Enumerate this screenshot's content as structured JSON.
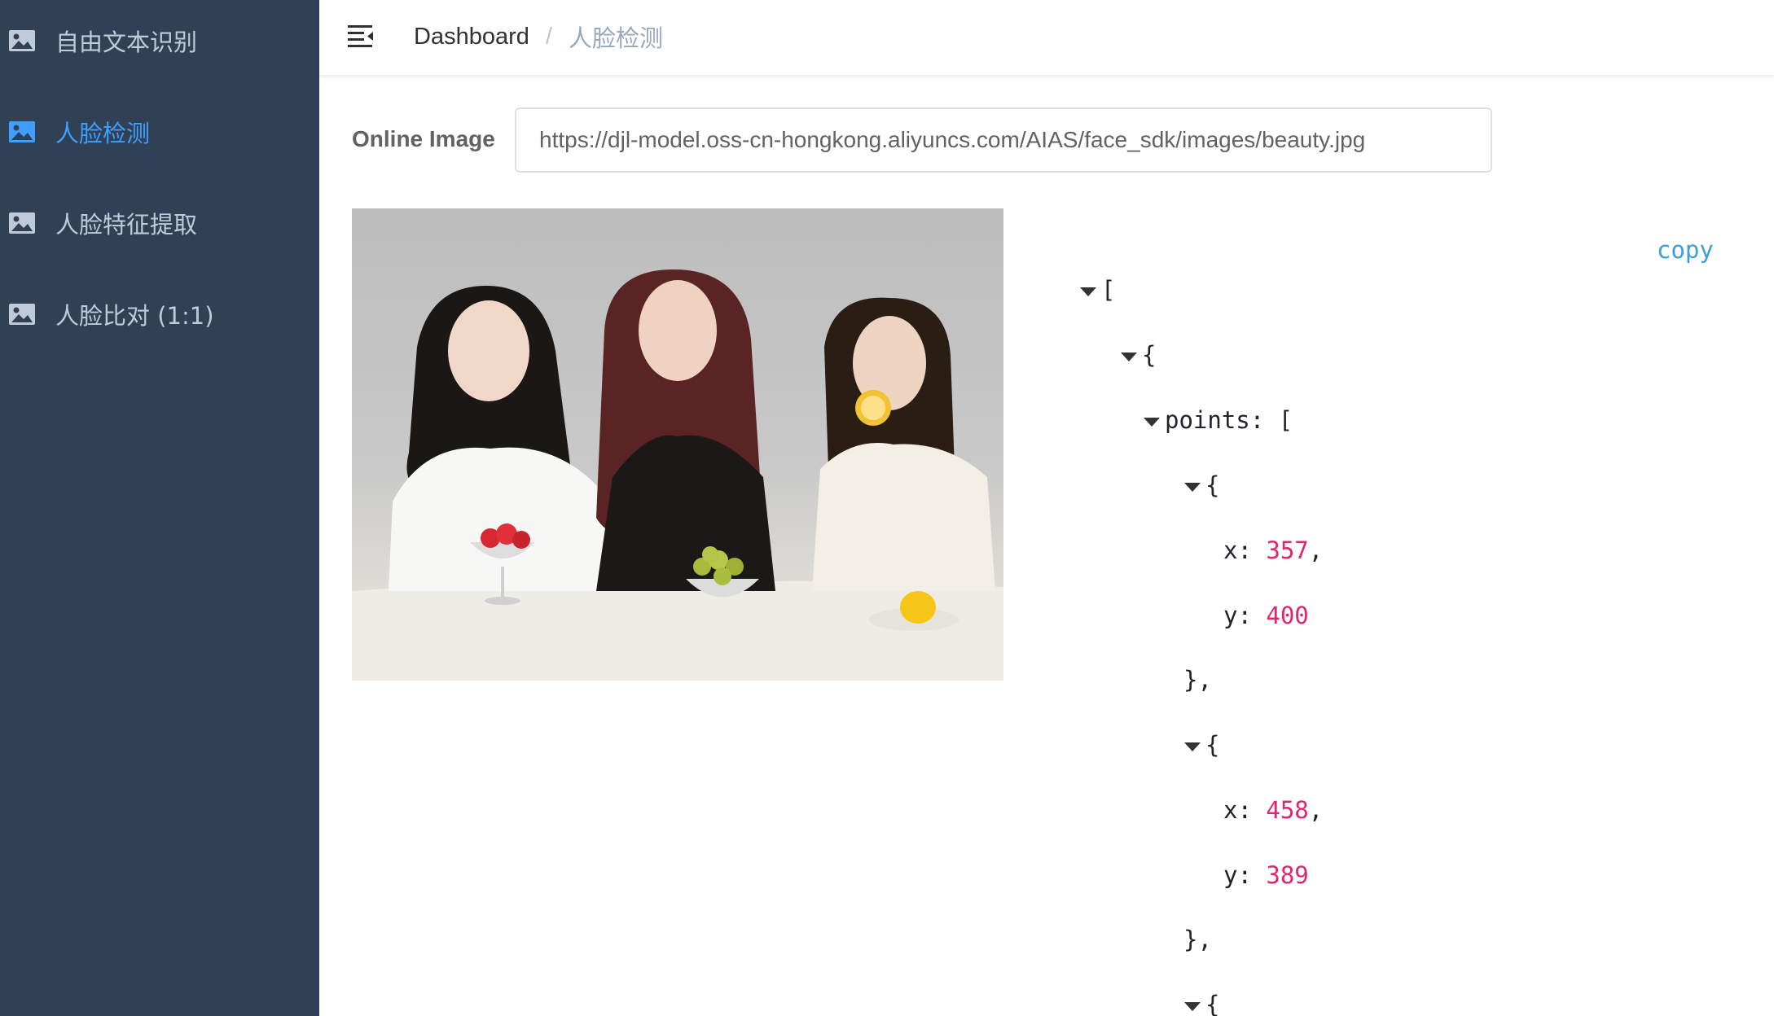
{
  "sidebar": {
    "items": [
      {
        "label": "自由文本识别",
        "icon": "image-icon",
        "active": false
      },
      {
        "label": "人脸检测",
        "icon": "image-icon",
        "active": true
      },
      {
        "label": "人脸特征提取",
        "icon": "image-icon",
        "active": false
      },
      {
        "label": "人脸比对 (1:1)",
        "icon": "image-icon",
        "active": false
      }
    ]
  },
  "header": {
    "menu_icon": "hamburger-icon",
    "breadcrumb": {
      "home": "Dashboard",
      "separator": "/",
      "current": "人脸检测"
    }
  },
  "form": {
    "online_image_label": "Online Image",
    "url_value": "https://djl-model.oss-cn-hongkong.aliyuncs.com/AIAS/face_sdk/images/beauty.jpg"
  },
  "json_panel": {
    "copy_label": "copy",
    "lines": {
      "open_array": "[",
      "open_obj": "{",
      "points_key": "points:",
      "points_bracket": "[",
      "p1_open": "{",
      "p1_x_key": "x:",
      "p1_x_val": "357",
      "p1_comma": ",",
      "p1_y_key": "y:",
      "p1_y_val": "400",
      "p1_close": "},",
      "p2_open": "{",
      "p2_x_key": "x:",
      "p2_x_val": "458",
      "p2_comma": ",",
      "p2_y_key": "y:",
      "p2_y_val": "389",
      "p2_close": "},",
      "p3_open": "{"
    }
  },
  "colors": {
    "sidebar_bg": "#304156",
    "sidebar_text": "#bfcbd9",
    "active": "#409eff",
    "json_number": "#e0266e",
    "copy": "#3aa0d8"
  }
}
